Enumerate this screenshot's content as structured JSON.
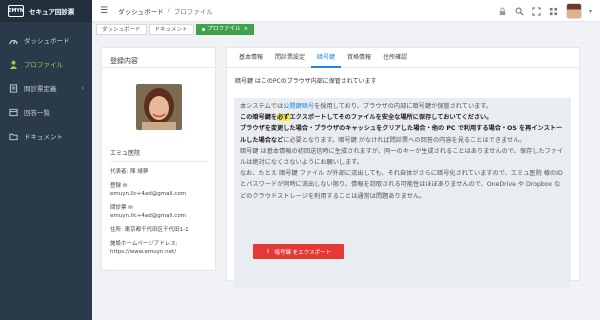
{
  "brand": {
    "logo": "EMYN",
    "title": "セキュア回診票"
  },
  "sidebar": {
    "items": [
      {
        "label": "ダッシュボード",
        "icon": "dashboard-icon",
        "active": false
      },
      {
        "label": "プロファイル",
        "icon": "user-icon",
        "active": true
      },
      {
        "label": "問診票定義",
        "icon": "form-icon",
        "active": false,
        "expandable": true
      },
      {
        "label": "回答一覧",
        "icon": "list-icon",
        "active": false
      },
      {
        "label": "ドキュメント",
        "icon": "folder-icon",
        "active": false
      }
    ]
  },
  "topbar": {
    "breadcrumb": [
      "ダッシュボード",
      "プロファイル"
    ],
    "separator": "/",
    "icons": [
      "lock-icon",
      "search-icon",
      "fullscreen-icon",
      "grid-icon",
      "user-avatar",
      "chevron-down-icon"
    ]
  },
  "tabstrip": {
    "tabs": [
      {
        "label": "ダッシュボード",
        "active": false
      },
      {
        "label": "ドキュメント",
        "active": false
      },
      {
        "label": "プロファイル",
        "active": true
      }
    ],
    "close_glyph": "×"
  },
  "profile_card": {
    "title": "登録内容",
    "org": "エミュ医院",
    "representative": "代表者: 陳 綺夢",
    "login_label": "登録",
    "login_email": "emuyn.llc+4ad@gmail.com",
    "inquiry_label": "問診票",
    "inquiry_email": "emuyn.llc+4ad@gmail.com",
    "address": "住所: 東京都千代田区千代田1-1",
    "homepage_label": "施設ホームページアドレス:",
    "homepage_url": "https://www.emuyn.net/"
  },
  "content_tabs": [
    {
      "label": "基本情報",
      "active": false
    },
    {
      "label": "問診票設定",
      "active": false
    },
    {
      "label": "暗号鍵",
      "active": true
    },
    {
      "label": "資格情報",
      "active": false
    },
    {
      "label": "住所確認",
      "active": false
    }
  ],
  "notice_title": "暗号鍵 はこのPCのブラウザ内部に保管されています",
  "panel": {
    "p1_pre": "本システムでは",
    "p1_link": "公開鍵暗号",
    "p1_post": "を採用しており、ブラウザの内部に暗号鍵が保管されています。",
    "p2_a": "この暗号鍵を",
    "p2_hl": "必ず",
    "p2_b": "エクスポートしてそのファイルを安全な場所に保存しておいてください。",
    "p3_bold": "ブラウザを変更した場合・ブラウザのキャッシュをクリアした場合・他の PC で利用する場合・OS を再インストールした場合など",
    "p3_rest": "に必要となります。暗号鍵 がなければ問診票への回答の内容を見ることはできません。",
    "p4": "暗号鍵 は基本情報の初回送信時に生成されますが、同一のキーが生成されることはありませんので、保存したファイルは絶対になくさないようにお願いします。",
    "p5": "なお、たとえ 暗号鍵 ファイル が外部に流出しても、それ自体がさらに暗号化されていますので、エミュ医院 様のIDとパスワードが同時に流出しない限り、情報を窃取される可能性はほぼありませんので、OneDrive や Dropbox などのクラウドストレージを利用することは通常は問題ありません。"
  },
  "export_button": {
    "icon": "download-icon",
    "label": "暗号鍵 をエクスポート"
  }
}
